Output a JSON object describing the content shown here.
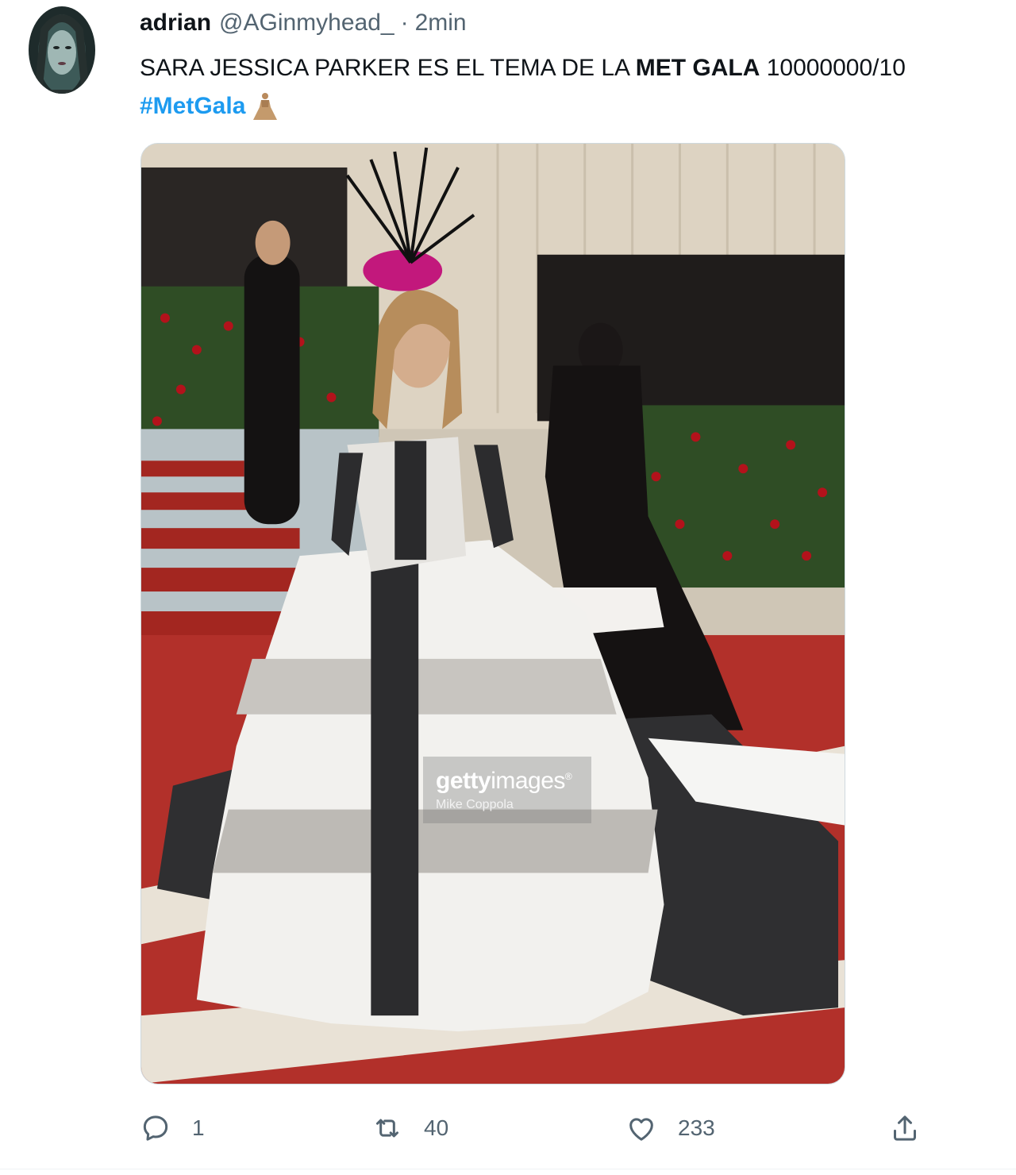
{
  "tweet": {
    "author": {
      "display_name": "adrian",
      "handle": "@AGinmyhead_",
      "separator": "·",
      "time": "2min"
    },
    "text": {
      "part1": "SARA JESSICA PARKER ES EL TEMA DE LA ",
      "bold": "MET GALA",
      "part2": " 10000000/10",
      "hashtag": "#MetGala",
      "emoji_name": "dress-emoji-icon"
    },
    "media": {
      "watermark_brand_bold": "getty",
      "watermark_brand_light": "images",
      "watermark_registered": "®",
      "watermark_credit": "Mike Coppola"
    },
    "actions": {
      "reply_count": "1",
      "retweet_count": "40",
      "like_count": "233"
    },
    "colors": {
      "link": "#1d9bf0",
      "secondary_text": "#536471",
      "primary_text": "#0f1419"
    }
  }
}
